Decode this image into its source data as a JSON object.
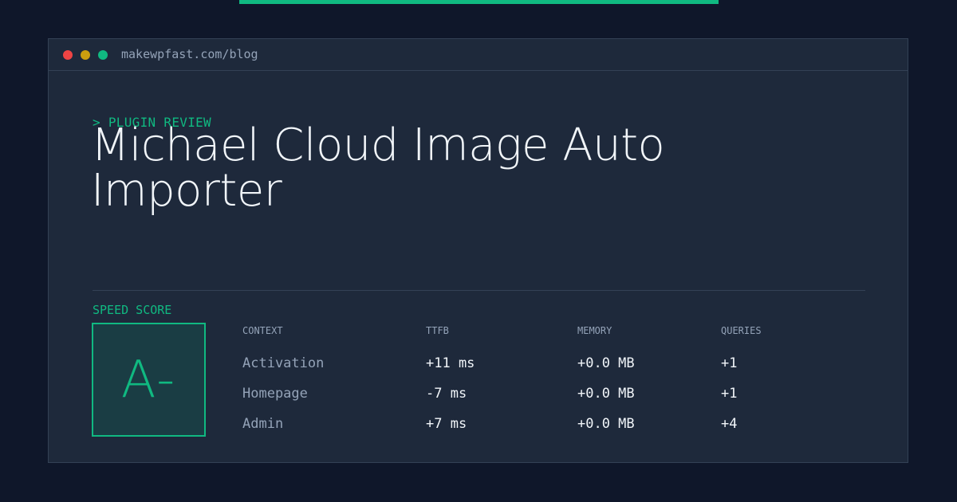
{
  "window": {
    "url": "makewpfast.com/blog"
  },
  "article": {
    "kicker": "> PLUGIN REVIEW",
    "title": "Michael Cloud Image Auto Importer"
  },
  "speed": {
    "label": "SPEED SCORE",
    "grade": "A-"
  },
  "table": {
    "headers": [
      "CONTEXT",
      "TTFB",
      "MEMORY",
      "QUERIES"
    ],
    "rows": [
      {
        "context": "Activation",
        "ttfb": "+11 ms",
        "memory": "+0.0 MB",
        "queries": "+1"
      },
      {
        "context": "Homepage",
        "ttfb": "-7 ms",
        "memory": "+0.0 MB",
        "queries": "+1"
      },
      {
        "context": "Admin",
        "ttfb": "+7 ms",
        "memory": "+0.0 MB",
        "queries": "+4"
      }
    ]
  },
  "colors": {
    "background": "#0f172a",
    "panel": "#1e293b",
    "accent": "#10b981",
    "dot_red": "#ef4444",
    "dot_yellow": "#eab308",
    "dot_green": "#10b981"
  }
}
